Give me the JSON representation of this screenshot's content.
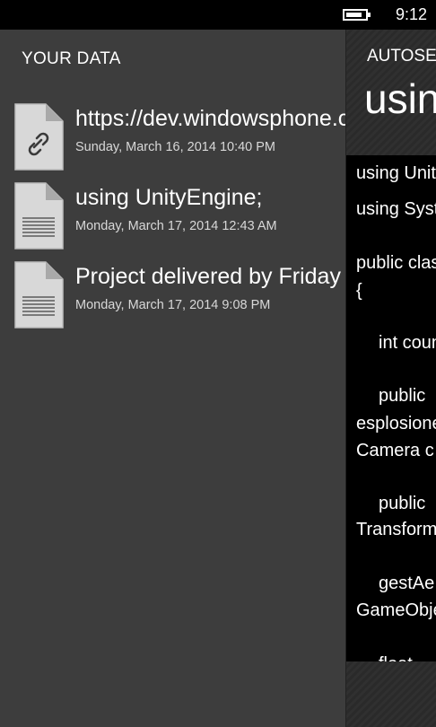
{
  "status": {
    "time": "9:12",
    "battery_level": 0.85
  },
  "left": {
    "section_title": "YOUR DATA",
    "items": [
      {
        "title": "https://dev.windowsphone.com",
        "date": "Sunday, March 16, 2014 10:40 PM",
        "icon": "link-file-icon"
      },
      {
        "title": "using UnityEngine;",
        "date": "Monday, March 17, 2014 12:43 AM",
        "icon": "text-file-icon"
      },
      {
        "title": "Project delivered by Friday",
        "date": "Monday, March 17, 2014 9:08 PM",
        "icon": "text-file-icon"
      }
    ]
  },
  "right": {
    "header": "AUTOSEND",
    "title": "using",
    "code_lines": [
      "using UnityEngine;",
      "using System.Collections;",
      "public class",
      "{",
      "int count",
      "public",
      "esplosione",
      "Camera c",
      "public",
      "Transform",
      "gestAe",
      "GameObject",
      "float"
    ]
  }
}
